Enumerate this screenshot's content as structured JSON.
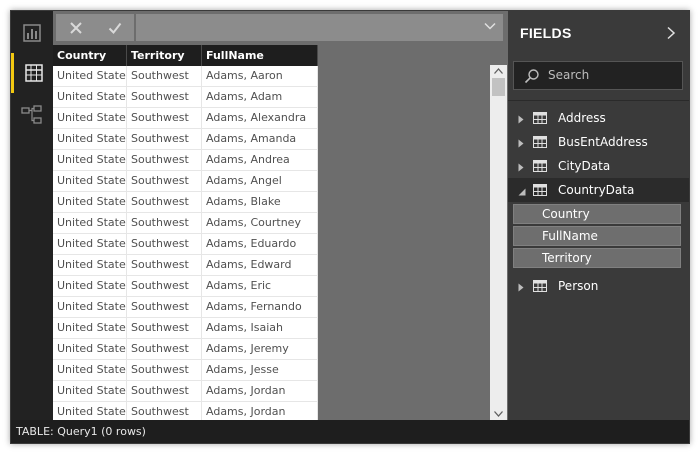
{
  "nav": {
    "report_icon": "bar-chart-icon",
    "data_icon": "table-grid-icon",
    "relationships_icon": "relationships-icon",
    "active": "data"
  },
  "formula_bar": {
    "cancel_icon": "close-icon",
    "commit_icon": "check-icon",
    "value": "",
    "dropdown_icon": "chevron-down-icon"
  },
  "table": {
    "columns": [
      "Country",
      "Territory",
      "FullName"
    ],
    "rows": [
      [
        "United States",
        "Southwest",
        "Adams, Aaron"
      ],
      [
        "United States",
        "Southwest",
        "Adams, Adam"
      ],
      [
        "United States",
        "Southwest",
        "Adams, Alexandra"
      ],
      [
        "United States",
        "Southwest",
        "Adams, Amanda"
      ],
      [
        "United States",
        "Southwest",
        "Adams, Andrea"
      ],
      [
        "United States",
        "Southwest",
        "Adams, Angel"
      ],
      [
        "United States",
        "Southwest",
        "Adams, Blake"
      ],
      [
        "United States",
        "Southwest",
        "Adams, Courtney"
      ],
      [
        "United States",
        "Southwest",
        "Adams, Eduardo"
      ],
      [
        "United States",
        "Southwest",
        "Adams, Edward"
      ],
      [
        "United States",
        "Southwest",
        "Adams, Eric"
      ],
      [
        "United States",
        "Southwest",
        "Adams, Fernando"
      ],
      [
        "United States",
        "Southwest",
        "Adams, Isaiah"
      ],
      [
        "United States",
        "Southwest",
        "Adams, Jeremy"
      ],
      [
        "United States",
        "Southwest",
        "Adams, Jesse"
      ],
      [
        "United States",
        "Southwest",
        "Adams, Jordan"
      ],
      [
        "United States",
        "Southwest",
        "Adams, Jordan"
      ]
    ]
  },
  "fields_pane": {
    "title": "FIELDS",
    "collapse_icon": "chevron-right-icon",
    "search_placeholder": "Search",
    "tables": [
      {
        "name": "Address",
        "expanded": false,
        "fields": []
      },
      {
        "name": "BusEntAddress",
        "expanded": false,
        "fields": []
      },
      {
        "name": "CityData",
        "expanded": false,
        "fields": []
      },
      {
        "name": "CountryData",
        "expanded": true,
        "fields": [
          "Country",
          "FullName",
          "Territory"
        ]
      },
      {
        "name": "Person",
        "expanded": false,
        "fields": []
      }
    ]
  },
  "status_bar": {
    "text": "TABLE: Query1 (0 rows)"
  },
  "colors": {
    "accent": "#f2c811",
    "nav_bg": "#222222",
    "pane_bg": "#3a3a3a",
    "canvas_bg": "#6d6d6d"
  }
}
